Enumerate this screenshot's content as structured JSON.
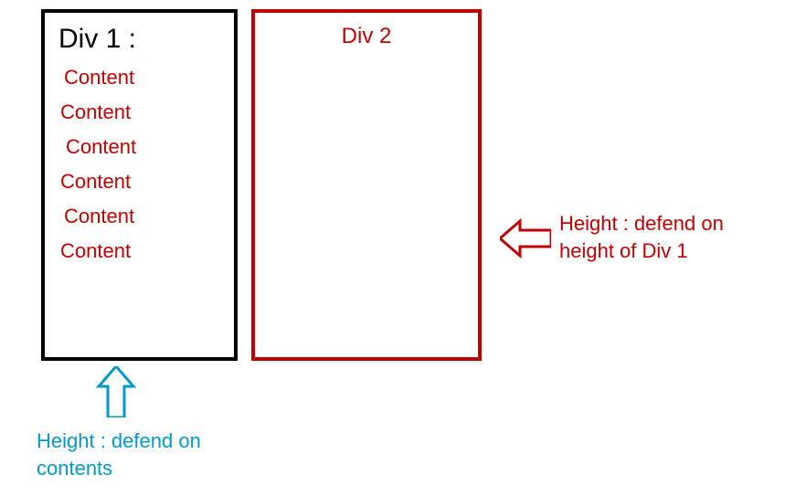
{
  "div1": {
    "title": "Div 1 :",
    "items": [
      "Content",
      "Content",
      "Content",
      "Content",
      "Content",
      "Content"
    ]
  },
  "div2": {
    "title": "Div 2"
  },
  "annotations": {
    "right_line1": "Height : defend on",
    "right_line2": "height of Div 1",
    "bottom_line1": "Height : defend on",
    "bottom_line2": "contents"
  },
  "colors": {
    "div1_border": "#000000",
    "div2_border": "#c00000",
    "content_text": "#c00000",
    "arrow_right": "#c00000",
    "arrow_bottom": "#0099cc"
  }
}
